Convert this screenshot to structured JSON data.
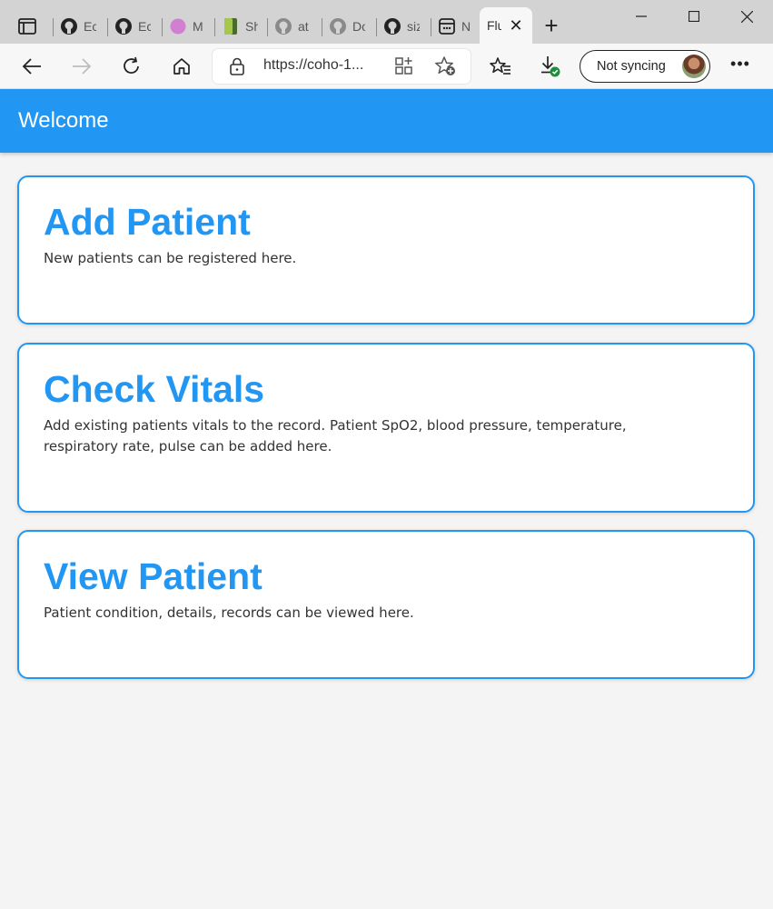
{
  "browser": {
    "tabs": [
      {
        "title": "Ec",
        "icon": "github-icon"
      },
      {
        "title": "Ec",
        "icon": "github-icon"
      },
      {
        "title": "M",
        "icon": "pink-circle-icon"
      },
      {
        "title": "Sh",
        "icon": "green-book-icon"
      },
      {
        "title": "at",
        "icon": "github-icon"
      },
      {
        "title": "Do",
        "icon": "github-icon"
      },
      {
        "title": "siz",
        "icon": "github-icon"
      },
      {
        "title": "N",
        "icon": "app-window-icon"
      },
      {
        "title": "Flu",
        "icon": "none",
        "active": true
      }
    ],
    "address": {
      "url": "https://coho-1..."
    },
    "sync": {
      "label": "Not syncing"
    },
    "colors": {
      "tabstrip": "#d3d3d3",
      "toolbar": "#f7f7f7"
    }
  },
  "app": {
    "title": "Welcome",
    "accent": "#2196f3",
    "cards": [
      {
        "title": "Add Patient",
        "description": "New patients can be registered here."
      },
      {
        "title": "Check Vitals",
        "description": "Add existing patients vitals to the record. Patient SpO2, blood pressure, temperature, respiratory rate, pulse can be added here."
      },
      {
        "title": "View Patient",
        "description": "Patient condition, details, records can be viewed here."
      }
    ]
  }
}
